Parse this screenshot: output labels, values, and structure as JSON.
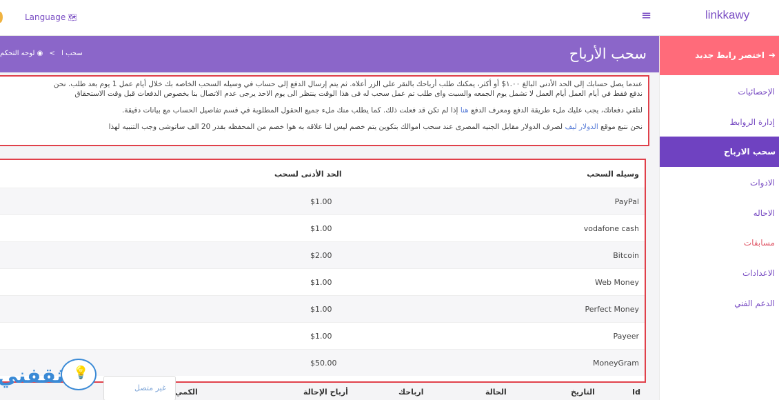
{
  "topbar": {
    "brand": "linkkawy",
    "language_label": "Language",
    "language_icon": "🗺",
    "menu_icon": "≡"
  },
  "sidebar": {
    "cta_label": "اختصر رابط جديد",
    "cta_icon": "➜",
    "items": [
      {
        "label": "الإحصائيات"
      },
      {
        "label": "إدارة الروابط"
      },
      {
        "label": "سحب الارباح"
      },
      {
        "label": "الادوات"
      },
      {
        "label": "الاحاله"
      },
      {
        "label": "مسابقات"
      },
      {
        "label": "الاعدادات"
      },
      {
        "label": "الدعم الفني"
      }
    ]
  },
  "banner": {
    "title": "سحب الأرباح",
    "breadcrumb_home": "لوحه التحكم",
    "breadcrumb_current": "سحب ا",
    "breadcrumb_sep": ">"
  },
  "notice": {
    "line1": "عندما يصل حسابك إلى الحد الأدنى البالغ ‎$‎١.٠٠ أو أكثر، يمكنك طلب أرباحك بالنقر على الزر أعلاه. ثم يتم إرسال الدفع إلى حساب في وسيله السحب الخاصه بك خلال أيام عمل 1 يوم بعد طلب. نحن",
    "line2": "ندفع فقط في أيام العمل أيام العمل لا تشمل يوم الجمعه والسبت واى طلب تم عمل سحب له فى هذا الوقت ينتظر الى يوم الاحد يرجى عدم الاتصال بنا بخصوص الدفعات قبل وقت الاستحقاق",
    "line3_pre": "لتلقي دفعاتك، يجب عليك ملء طريقة الدفع ومعرف الدفع ",
    "line3_link": "هنا",
    "line3_post": " إذا لم تكن قد فعلت ذلك. كما يطلب منك ملء جميع الحقول المطلوبة في قسم تفاصيل الحساب مع بيانات دقيقة.",
    "line4_pre": "نحن نتبع موقع ",
    "line4_link": "الدولار ليف",
    "line4_post": " لصرف الدولار مقابل الجنيه المصرى عند سحب اموالك بتكوين يتم خصم ليس لنا علاقه به هوا خصم من المحفظه بقدر 20 الف ساتوشى وجب التنبيه لهذا"
  },
  "methods_table": {
    "headers": {
      "method": "وسيله السحب",
      "minimum": "الحد الأدنى لسحب"
    },
    "rows": [
      {
        "method": "PayPal",
        "minimum": "$1.00"
      },
      {
        "method": "vodafone cash",
        "minimum": "$1.00"
      },
      {
        "method": "Bitcoin",
        "minimum": "$2.00"
      },
      {
        "method": "Web Money",
        "minimum": "$1.00"
      },
      {
        "method": "Perfect Money",
        "minimum": "$1.00"
      },
      {
        "method": "Payeer",
        "minimum": "$1.00"
      },
      {
        "method": "MoneyGram",
        "minimum": "$50.00"
      }
    ]
  },
  "withdrawals_table": {
    "headers": {
      "id": "Id",
      "date": "التاريخ",
      "status": "الحالة",
      "earnings": "ارباحك",
      "referral": "أرباح الإحالة",
      "amount": "الكمي"
    }
  },
  "chat": {
    "status": "غير متصل"
  },
  "watermark": {
    "text": "ثقفني"
  }
}
